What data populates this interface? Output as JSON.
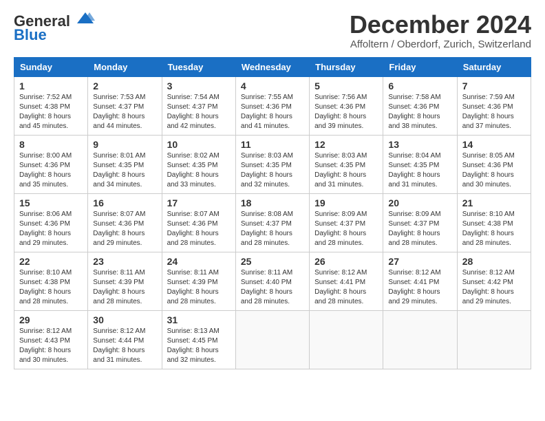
{
  "header": {
    "logo_general": "General",
    "logo_blue": "Blue",
    "month_title": "December 2024",
    "location": "Affoltern / Oberdorf, Zurich, Switzerland"
  },
  "weekdays": [
    "Sunday",
    "Monday",
    "Tuesday",
    "Wednesday",
    "Thursday",
    "Friday",
    "Saturday"
  ],
  "weeks": [
    [
      {
        "day": "1",
        "sunrise": "7:52 AM",
        "sunset": "4:38 PM",
        "daylight": "8 hours and 45 minutes."
      },
      {
        "day": "2",
        "sunrise": "7:53 AM",
        "sunset": "4:37 PM",
        "daylight": "8 hours and 44 minutes."
      },
      {
        "day": "3",
        "sunrise": "7:54 AM",
        "sunset": "4:37 PM",
        "daylight": "8 hours and 42 minutes."
      },
      {
        "day": "4",
        "sunrise": "7:55 AM",
        "sunset": "4:36 PM",
        "daylight": "8 hours and 41 minutes."
      },
      {
        "day": "5",
        "sunrise": "7:56 AM",
        "sunset": "4:36 PM",
        "daylight": "8 hours and 39 minutes."
      },
      {
        "day": "6",
        "sunrise": "7:58 AM",
        "sunset": "4:36 PM",
        "daylight": "8 hours and 38 minutes."
      },
      {
        "day": "7",
        "sunrise": "7:59 AM",
        "sunset": "4:36 PM",
        "daylight": "8 hours and 37 minutes."
      }
    ],
    [
      {
        "day": "8",
        "sunrise": "8:00 AM",
        "sunset": "4:36 PM",
        "daylight": "8 hours and 35 minutes."
      },
      {
        "day": "9",
        "sunrise": "8:01 AM",
        "sunset": "4:35 PM",
        "daylight": "8 hours and 34 minutes."
      },
      {
        "day": "10",
        "sunrise": "8:02 AM",
        "sunset": "4:35 PM",
        "daylight": "8 hours and 33 minutes."
      },
      {
        "day": "11",
        "sunrise": "8:03 AM",
        "sunset": "4:35 PM",
        "daylight": "8 hours and 32 minutes."
      },
      {
        "day": "12",
        "sunrise": "8:03 AM",
        "sunset": "4:35 PM",
        "daylight": "8 hours and 31 minutes."
      },
      {
        "day": "13",
        "sunrise": "8:04 AM",
        "sunset": "4:35 PM",
        "daylight": "8 hours and 31 minutes."
      },
      {
        "day": "14",
        "sunrise": "8:05 AM",
        "sunset": "4:36 PM",
        "daylight": "8 hours and 30 minutes."
      }
    ],
    [
      {
        "day": "15",
        "sunrise": "8:06 AM",
        "sunset": "4:36 PM",
        "daylight": "8 hours and 29 minutes."
      },
      {
        "day": "16",
        "sunrise": "8:07 AM",
        "sunset": "4:36 PM",
        "daylight": "8 hours and 29 minutes."
      },
      {
        "day": "17",
        "sunrise": "8:07 AM",
        "sunset": "4:36 PM",
        "daylight": "8 hours and 28 minutes."
      },
      {
        "day": "18",
        "sunrise": "8:08 AM",
        "sunset": "4:37 PM",
        "daylight": "8 hours and 28 minutes."
      },
      {
        "day": "19",
        "sunrise": "8:09 AM",
        "sunset": "4:37 PM",
        "daylight": "8 hours and 28 minutes."
      },
      {
        "day": "20",
        "sunrise": "8:09 AM",
        "sunset": "4:37 PM",
        "daylight": "8 hours and 28 minutes."
      },
      {
        "day": "21",
        "sunrise": "8:10 AM",
        "sunset": "4:38 PM",
        "daylight": "8 hours and 28 minutes."
      }
    ],
    [
      {
        "day": "22",
        "sunrise": "8:10 AM",
        "sunset": "4:38 PM",
        "daylight": "8 hours and 28 minutes."
      },
      {
        "day": "23",
        "sunrise": "8:11 AM",
        "sunset": "4:39 PM",
        "daylight": "8 hours and 28 minutes."
      },
      {
        "day": "24",
        "sunrise": "8:11 AM",
        "sunset": "4:39 PM",
        "daylight": "8 hours and 28 minutes."
      },
      {
        "day": "25",
        "sunrise": "8:11 AM",
        "sunset": "4:40 PM",
        "daylight": "8 hours and 28 minutes."
      },
      {
        "day": "26",
        "sunrise": "8:12 AM",
        "sunset": "4:41 PM",
        "daylight": "8 hours and 28 minutes."
      },
      {
        "day": "27",
        "sunrise": "8:12 AM",
        "sunset": "4:41 PM",
        "daylight": "8 hours and 29 minutes."
      },
      {
        "day": "28",
        "sunrise": "8:12 AM",
        "sunset": "4:42 PM",
        "daylight": "8 hours and 29 minutes."
      }
    ],
    [
      {
        "day": "29",
        "sunrise": "8:12 AM",
        "sunset": "4:43 PM",
        "daylight": "8 hours and 30 minutes."
      },
      {
        "day": "30",
        "sunrise": "8:12 AM",
        "sunset": "4:44 PM",
        "daylight": "8 hours and 31 minutes."
      },
      {
        "day": "31",
        "sunrise": "8:13 AM",
        "sunset": "4:45 PM",
        "daylight": "8 hours and 32 minutes."
      },
      null,
      null,
      null,
      null
    ]
  ]
}
